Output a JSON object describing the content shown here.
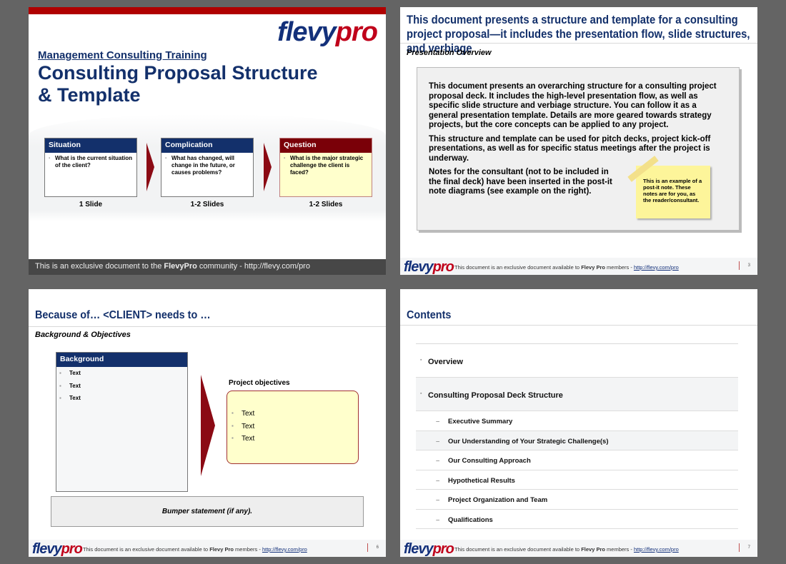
{
  "brand": {
    "logo_left": "flevy",
    "logo_right": "pro"
  },
  "slide1": {
    "subtitle": "Management Consulting Training",
    "title_line1": "Consulting Proposal Structure",
    "title_line2": "& Template",
    "boxes": [
      {
        "header": "Situation",
        "bullet": "What is the current situation of the client?",
        "caption": "1 Slide"
      },
      {
        "header": "Complication",
        "bullet": "What has changed, will change in the future, or causes problems?",
        "caption": "1-2 Slides"
      },
      {
        "header": "Question",
        "bullet": "What is the major strategic challenge the client is faced?",
        "caption": "1-2 Slides"
      }
    ],
    "footer_pre": "This is an exclusive document to the ",
    "footer_bold": "FlevyPro",
    "footer_post": " community - http://flevy.com/pro"
  },
  "footer": {
    "pre": "This document is an exclusive document available to ",
    "bold": "Flevy Pro",
    "mid": " members - ",
    "link": "http://flevy.com/pro"
  },
  "slide2": {
    "title": "This document presents a structure and template for a consulting project proposal—it includes the presentation flow, slide structures, and verbiage",
    "section": "Presentation Overview",
    "paragraphs": [
      "This document presents an overarching structure for a consulting project proposal deck.  It includes the high-level presentation flow, as well as specific slide structure and verbiage structure.  You can follow it as a general presentation template.  Details are more geared towards strategy projects, but the core concepts can be applied to any project.",
      "This structure and template can be used for pitch decks, project kick-off presentations, as well as for specific status meetings after the project is underway.",
      "Notes for the consultant (not to be included in the final deck) have been inserted in the post-it note diagrams (see example on the right)."
    ],
    "postit": "This is an example of a post-it note.  These notes are for you, as the reader/consultant.",
    "page": "3"
  },
  "slide3": {
    "title": "Because of… <CLIENT> needs to …",
    "section": "Background & Objectives",
    "background_header": "Background",
    "background_items": [
      "Text",
      "Text",
      "Text"
    ],
    "objectives_label": "Project objectives",
    "objectives_items": [
      "Text",
      "Text",
      "Text"
    ],
    "bumper": "Bumper statement (if any).",
    "page": "6"
  },
  "slide4": {
    "title": "Contents",
    "items": [
      {
        "label": "Overview",
        "level": 1,
        "shaded": false
      },
      {
        "label": "Consulting Proposal Deck Structure",
        "level": 1,
        "shaded": true
      },
      {
        "label": "Executive Summary",
        "level": 2,
        "shaded": false
      },
      {
        "label": "Our Understanding of Your Strategic Challenge(s)",
        "level": 2,
        "shaded": true
      },
      {
        "label": "Our Consulting Approach",
        "level": 2,
        "shaded": false
      },
      {
        "label": "Hypothetical Results",
        "level": 2,
        "shaded": false
      },
      {
        "label": "Project Organization and Team",
        "level": 2,
        "shaded": false
      },
      {
        "label": "Qualifications",
        "level": 2,
        "shaded": false
      }
    ],
    "page": "7"
  },
  "colors": {
    "navy": "#13306b",
    "dark_red": "#8b0a14",
    "brand_red": "#c0001a",
    "postit": "#fdf59a",
    "yellow_box": "#ffffcc"
  }
}
